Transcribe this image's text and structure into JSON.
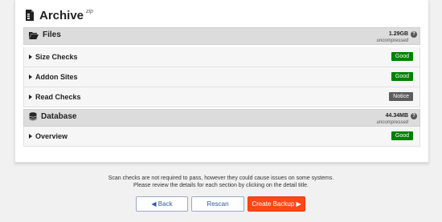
{
  "archive": {
    "title": "Archive",
    "sub": "zip"
  },
  "files": {
    "title": "Files",
    "size": "1.29GB",
    "size_sub": "uncompressed"
  },
  "database": {
    "title": "Database",
    "size": "44.34MB",
    "size_sub": "uncompressed"
  },
  "checks": [
    {
      "label": "Size Checks",
      "status": "Good"
    },
    {
      "label": "Addon Sites",
      "status": "Good"
    },
    {
      "label": "Read Checks",
      "status": "Notice"
    },
    {
      "label": "Overview",
      "status": "Good"
    }
  ],
  "help_glyph": "?",
  "note": {
    "line1": "Scan checks are not required to pass, however they could cause issues on some systems.",
    "line2": "Please review the details for each section by clicking on the detail title."
  },
  "buttons": {
    "back": "◀ Back",
    "rescan": "Rescan",
    "create": "Create Backup ▶"
  },
  "colors": {
    "good": "#008000",
    "notice": "#5d5d5d",
    "primary": "#fe4716",
    "header_bg": "#dcdcdc"
  }
}
